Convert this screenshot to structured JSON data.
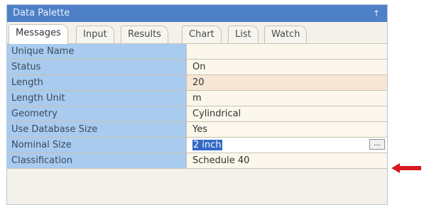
{
  "panel": {
    "title": "Data Palette",
    "pin_glyph": "↑"
  },
  "tabs": [
    {
      "label": "Messages",
      "active": true
    },
    {
      "label": "Input",
      "active": false
    },
    {
      "label": "Results",
      "active": false
    },
    {
      "label": "Chart",
      "active": false
    },
    {
      "label": "List",
      "active": false
    },
    {
      "label": "Watch",
      "active": false
    }
  ],
  "properties": [
    {
      "name": "Unique Name",
      "value": ""
    },
    {
      "name": "Status",
      "value": "On"
    },
    {
      "name": "Length",
      "value": "20"
    },
    {
      "name": "Length Unit",
      "value": "m"
    },
    {
      "name": "Geometry",
      "value": "Cylindrical"
    },
    {
      "name": "Use Database Size",
      "value": "Yes"
    },
    {
      "name": "Nominal Size",
      "value": "2 inch",
      "editing": true,
      "button_label": "..."
    },
    {
      "name": "Classification",
      "value": "Schedule 40"
    }
  ],
  "colors": {
    "titlebar": "#4d80c6",
    "name_cell": "#a9cbef",
    "selection": "#316ac5",
    "arrow": "#d7191f"
  },
  "annotation": {
    "icon": "arrow-left-icon"
  }
}
